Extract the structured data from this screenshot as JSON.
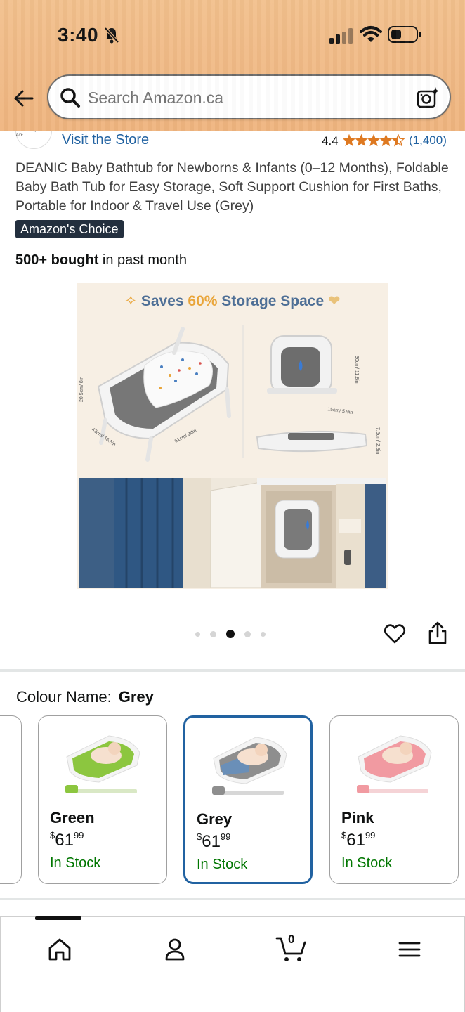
{
  "status_bar": {
    "time": "3:40"
  },
  "search": {
    "placeholder": "Search Amazon.ca"
  },
  "store": {
    "link_text": "Visit the Store",
    "logo_text": "Taste a Different Life"
  },
  "rating": {
    "value": "4.4",
    "stars": 4.4,
    "count": "(1,400)"
  },
  "product": {
    "title": "DEANIC Baby Bathtub for Newborns & Infants (0–12 Months), Foldable Baby Bath Tub for Easy Storage, Soft Support Cushion for First Baths, Portable for Indoor & Travel Use (Grey)",
    "badge": "Amazon's Choice",
    "bought_bold": "500+ bought",
    "bought_rest": " in past month"
  },
  "image": {
    "headline_pre": "Saves ",
    "headline_highlight": "60%",
    "headline_post": " Storage Space",
    "dim_height": "20.5cm/ 8in",
    "dim_width": "42cm/ 16.5in",
    "dim_length": "61cm/ 24in",
    "dim_folded_h": "30cm/ 11.8in",
    "dim_folded_d": "15cm/ 5.9in",
    "dim_flat": "7.5cm/ 2.9in"
  },
  "carousel": {
    "count": 5,
    "active": 2
  },
  "colour": {
    "label": "Colour Name:",
    "selected": "Grey"
  },
  "swatches": [
    {
      "name": "Green",
      "price_whole": "61",
      "price_frac": "99",
      "currency": "$",
      "stock": "In Stock",
      "color": "#8cc63f"
    },
    {
      "name": "Grey",
      "price_whole": "61",
      "price_frac": "99",
      "currency": "$",
      "stock": "In Stock",
      "color": "#8e8e8e"
    },
    {
      "name": "Pink",
      "price_whole": "61",
      "price_frac": "99",
      "currency": "$",
      "stock": "In Stock",
      "color": "#f19aa1"
    }
  ],
  "nav": {
    "cart_count": "0"
  },
  "colors": {
    "link": "#2162a1",
    "stock": "#007600",
    "star": "#de7921",
    "badge_bg": "#232f3e",
    "selected_border": "#2162a1"
  }
}
